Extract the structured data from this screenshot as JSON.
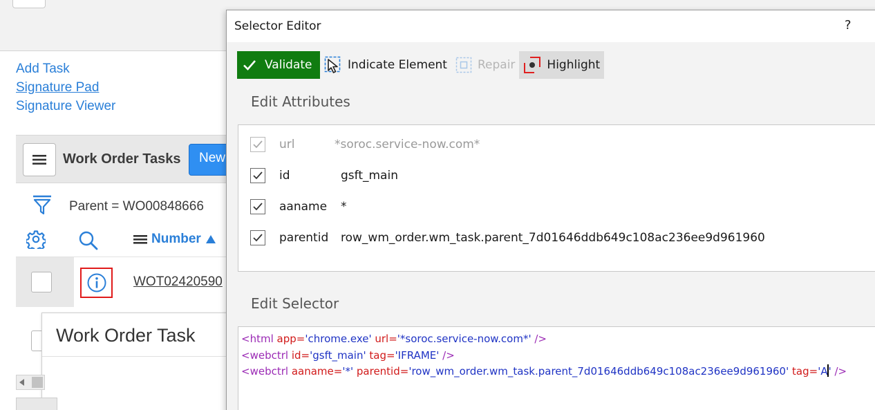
{
  "background": {
    "links": [
      "Add Task",
      "Signature Pad",
      "Signature Viewer"
    ],
    "list": {
      "title": "Work Order Tasks",
      "new_label": "New",
      "filter_text": "Parent = WO00848666",
      "column_number": "Number",
      "row1_number": "WOT02420590"
    },
    "popover_title": "Work Order Task"
  },
  "dialog": {
    "title": "Selector Editor",
    "help": "?",
    "toolbar": {
      "validate": "Validate",
      "indicate": "Indicate Element",
      "repair": "Repair",
      "highlight": "Highlight"
    },
    "edit_attributes_title": "Edit Attributes",
    "attributes": [
      {
        "name": "url",
        "value": "*soroc.service-now.com*",
        "checked": true,
        "enabled": false
      },
      {
        "name": "id",
        "value": "gsft_main",
        "checked": true,
        "enabled": true
      },
      {
        "name": "aaname",
        "value": "*",
        "checked": true,
        "enabled": true
      },
      {
        "name": "parentid",
        "value": "row_wm_order.wm_task.parent_7d01646ddb649c108ac236ee9d961960",
        "checked": true,
        "enabled": true
      }
    ],
    "edit_selector_title": "Edit Selector",
    "selector": {
      "l1_tag": "<html",
      "l1_a1": "app",
      "l1_v1": "'chrome.exe'",
      "l1_a2": "url",
      "l1_v2": "'*soroc.service-now.com*'",
      "l1_end": "/>",
      "l2_tag": "<webctrl",
      "l2_a1": "id",
      "l2_v1": "'gsft_main'",
      "l2_a2": "tag",
      "l2_v2": "'IFRAME'",
      "l2_end": "/>",
      "l3_tag": "<webctrl",
      "l3_a1": "aaname",
      "l3_v1": "'*'",
      "l3_a2": "parentid",
      "l3_v2": "'row_wm_order.wm_task.parent_7d01646ddb649c108ac236ee9d961960'",
      "l3_a3": "tag",
      "l3_v3a": "'A",
      "l3_v3b": "'",
      "l3_end": "/>"
    }
  },
  "colors": {
    "validate_green": "#107c10",
    "link_blue": "#2a7fd8",
    "new_button_blue": "#2f8ff2",
    "info_highlight_red": "#e01a1a",
    "selector_tag": "#9b2bb5",
    "selector_attr": "#d11a1a",
    "selector_value": "#1f33c4"
  },
  "icons": [
    "hamburger-icon",
    "filter-icon",
    "gear-icon",
    "search-icon",
    "sort-up-icon",
    "info-icon",
    "check-icon",
    "cursor-arrow-icon",
    "repair-icon",
    "highlight-icon"
  ]
}
